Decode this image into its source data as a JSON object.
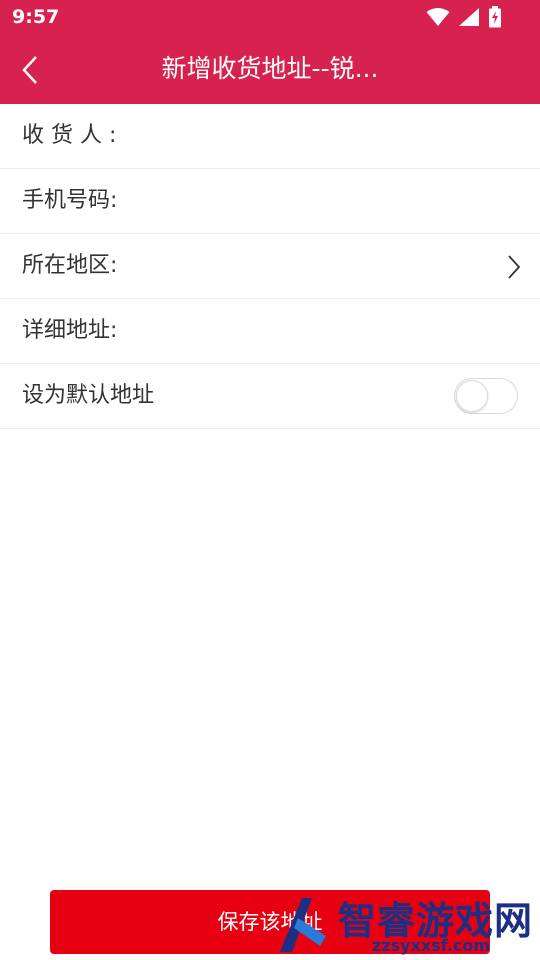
{
  "status_bar": {
    "time": "9:57"
  },
  "header": {
    "title": "新增收货地址--锐...",
    "bg_color": "#d7224f"
  },
  "form": {
    "receiver": {
      "label": "收 货 人 :"
    },
    "phone": {
      "label": "手机号码:"
    },
    "region": {
      "label": "所在地区:"
    },
    "address": {
      "label": "详细地址:"
    },
    "default": {
      "label": "设为默认地址",
      "enabled": false
    }
  },
  "save_button": {
    "label": "保存该地址",
    "color": "#e60012"
  },
  "watermark": {
    "text": "智睿游戏网",
    "url": "zzsyxxsf.com"
  }
}
